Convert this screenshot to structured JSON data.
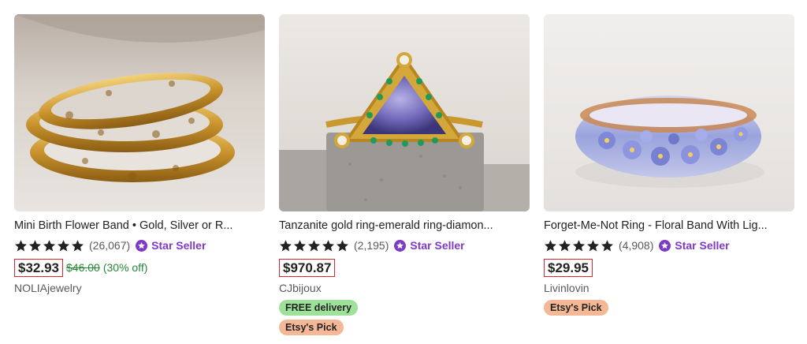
{
  "listings": [
    {
      "title": "Mini Birth Flower Band • Gold, Silver or R...",
      "rating": 5,
      "review_count": "(26,067)",
      "star_seller": "Star Seller",
      "price": "$32.93",
      "original_price": "$46.00",
      "discount": "(30% off)",
      "shop": "NOLIAjewelry",
      "badges": []
    },
    {
      "title": "Tanzanite gold ring-emerald ring-diamon...",
      "rating": 5,
      "review_count": "(2,195)",
      "star_seller": "Star Seller",
      "price": "$970.87",
      "shop": "CJbijoux",
      "badges": [
        "FREE delivery",
        "Etsy's Pick"
      ]
    },
    {
      "title": "Forget-Me-Not Ring - Floral Band With Lig...",
      "rating": 5,
      "review_count": "(4,908)",
      "star_seller": "Star Seller",
      "price": "$29.95",
      "shop": "Livinlovin",
      "badges": [
        "Etsy's Pick"
      ]
    }
  ],
  "colors": {
    "star_seller": "#7f39c8",
    "price_highlight_border": "#e1242b",
    "discount_text": "#258635",
    "free_delivery_badge": "#9ee29a",
    "etsys_pick_badge": "#f5b896"
  },
  "icons": {
    "rating": "star-icon",
    "star_seller": "star-seller-icon"
  }
}
